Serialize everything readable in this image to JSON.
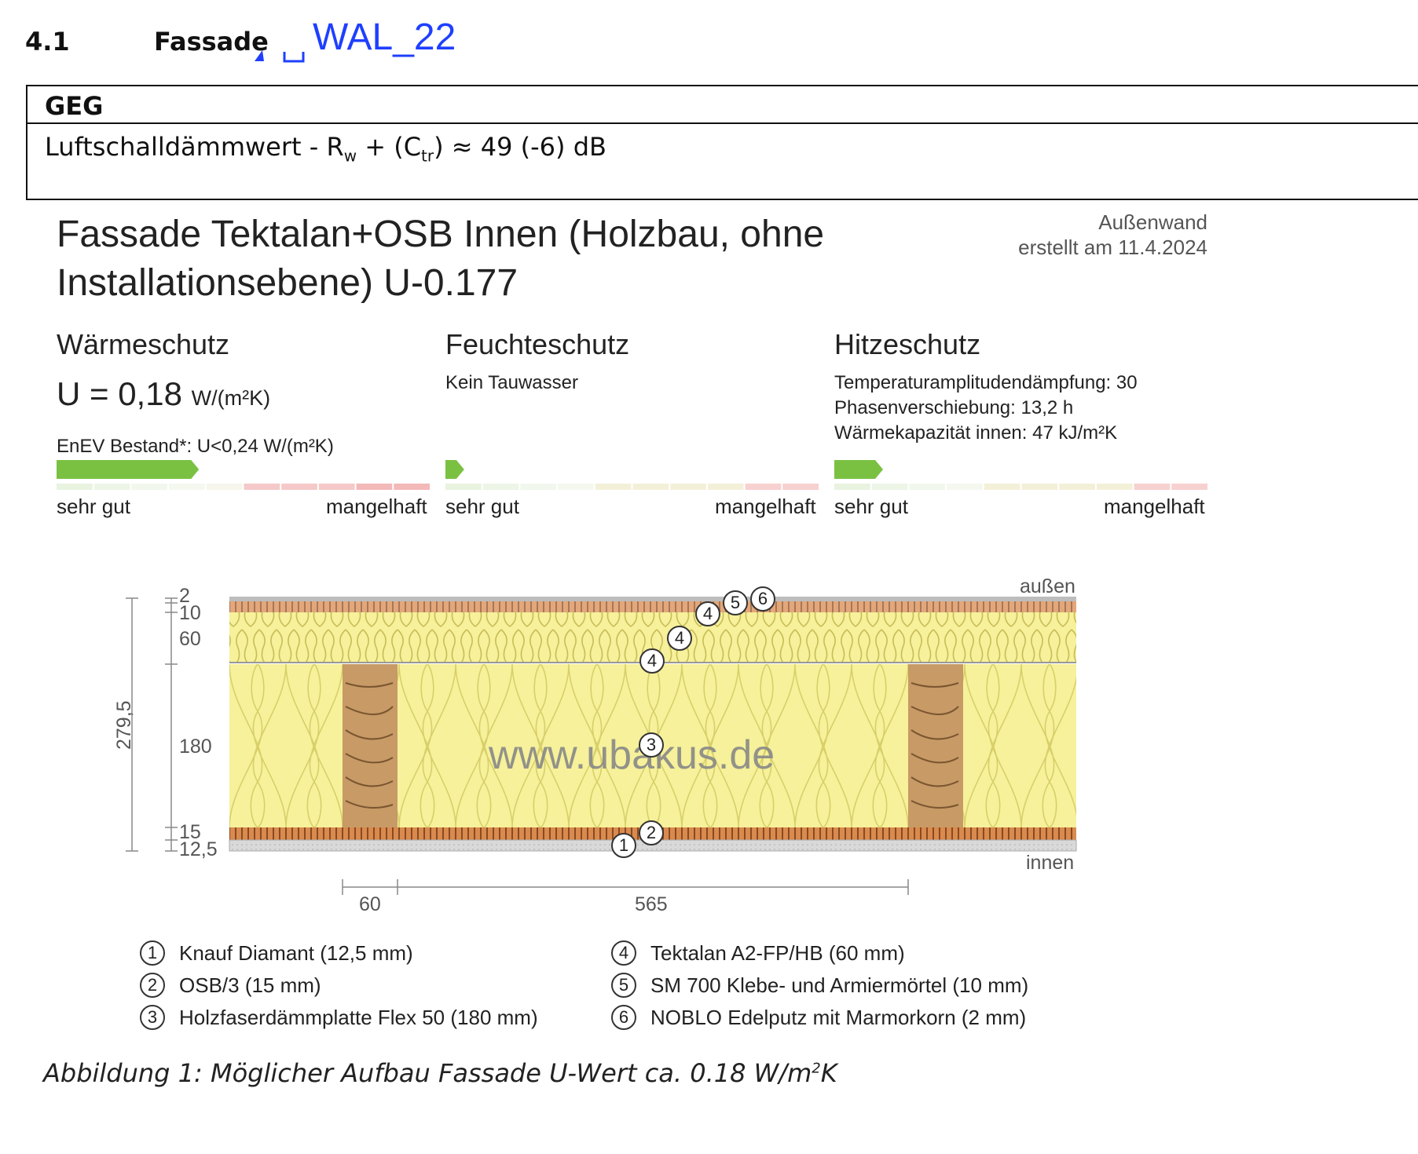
{
  "section": {
    "number": "4.1",
    "title": "Fassade",
    "annotation": "WAL_22"
  },
  "geg": {
    "header": "GEG",
    "line_prefix": "Luftschalldämmwert - R",
    "line_sub_w": "w",
    "line_mid": " + (C",
    "line_sub_tr": "tr",
    "line_suffix": ") ≈ 49 (-6) dB"
  },
  "report": {
    "title": "Fassade Tektalan+OSB Innen (Holzbau, ohne Installationsebene) U-0.177",
    "type": "Außenwand",
    "created": "erstellt am 11.4.2024"
  },
  "categories": [
    {
      "heading": "Wärmeschutz",
      "value": "U = 0,18",
      "unit": "W/(m²K)",
      "note": "EnEV Bestand*: U<0,24 W/(m²K)",
      "rating_fraction": 0.38
    },
    {
      "heading": "Feuchteschutz",
      "line1": "Kein Tauwasser",
      "rating_fraction": 0.05
    },
    {
      "heading": "Hitzeschutz",
      "line1": "Temperaturamplitudendämpfung: 30",
      "line2": "Phasenverschiebung: 13,2 h",
      "line3": "Wärmekapazität innen: 47 kJ/m²K",
      "rating_fraction": 0.13
    }
  ],
  "scale": {
    "good": "sehr gut",
    "bad": "mangelhaft"
  },
  "diagram": {
    "outside": "außen",
    "inside": "innen",
    "watermark": "www.ubakus.de",
    "total_thickness": "279,5",
    "layer_thicknesses": [
      "2",
      "10",
      "60",
      "180",
      "15",
      "12,5"
    ],
    "stud_width": "60",
    "stud_spacing": "565",
    "markers": [
      "1",
      "2",
      "3",
      "4",
      "4",
      "4",
      "5",
      "6"
    ]
  },
  "legend": [
    {
      "num": "1",
      "text": "Knauf Diamant (12,5 mm)"
    },
    {
      "num": "2",
      "text": "OSB/3 (15 mm)"
    },
    {
      "num": "3",
      "text": "Holzfaserdämmplatte Flex 50 (180 mm)"
    },
    {
      "num": "4",
      "text": "Tektalan A2-FP/HB (60 mm)"
    },
    {
      "num": "5",
      "text": "SM 700 Klebe- und Armiermörtel (10 mm)"
    },
    {
      "num": "6",
      "text": "NOBLO Edelputz mit Marmorkorn (2 mm)"
    }
  ],
  "caption": {
    "text": "Abbildung 1: Möglicher Aufbau Fassade U-Wert ca. 0.18 W/m",
    "sup": "2",
    "tail": "K"
  },
  "colors": {
    "good": "#7ac142",
    "bad": "#e88a8a",
    "insulation": "#f6f19a",
    "wood": "#c79a66",
    "annotation": "#1f3fff"
  }
}
